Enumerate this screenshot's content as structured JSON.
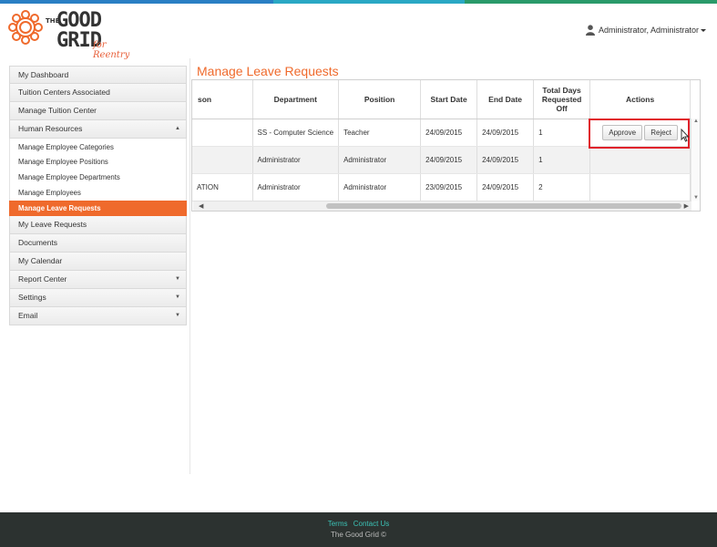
{
  "colors": {
    "accent": "#ef6a2c",
    "topbar": [
      "#2a7fc4",
      "#2aa8c4",
      "#2a9a6a"
    ],
    "highlight_box": "#e0202a",
    "footer_link": "#3bc1b5"
  },
  "header": {
    "logo": {
      "the": "THE",
      "good": "GOOD",
      "grid": "GRID",
      "tagline": "for Reentry"
    },
    "user_name": "Administrator, Administrator"
  },
  "sidebar": {
    "items": [
      {
        "label": "My Dashboard"
      },
      {
        "label": "Tuition Centers Associated"
      },
      {
        "label": "Manage Tuition Center"
      },
      {
        "label": "Human Resources",
        "expanded": true
      },
      {
        "label": "Manage Employee Categories"
      },
      {
        "label": "Manage Employee Positions"
      },
      {
        "label": "Manage Employee Departments"
      },
      {
        "label": "Manage Employees"
      },
      {
        "label": "Manage Leave Requests",
        "active": true
      },
      {
        "label": "My Leave Requests"
      },
      {
        "label": "Documents"
      },
      {
        "label": "My Calendar"
      },
      {
        "label": "Report Center"
      },
      {
        "label": "Settings"
      },
      {
        "label": "Email"
      }
    ]
  },
  "main": {
    "title": "Manage Leave Requests",
    "table": {
      "headers": {
        "reason": "son",
        "department": "Department",
        "position": "Position",
        "start_date": "Start Date",
        "end_date": "End Date",
        "total_days": "Total Days Requested Off",
        "actions": "Actions"
      },
      "rows": [
        {
          "reason": "",
          "department": "SS - Computer Science",
          "position": "Teacher",
          "start_date": "24/09/2015",
          "end_date": "24/09/2015",
          "total_days": "1",
          "has_actions": true
        },
        {
          "reason": "",
          "department": "Administrator",
          "position": "Administrator",
          "start_date": "24/09/2015",
          "end_date": "24/09/2015",
          "total_days": "1",
          "has_actions": false
        },
        {
          "reason": "ATION",
          "department": "Administrator",
          "position": "Administrator",
          "start_date": "23/09/2015",
          "end_date": "24/09/2015",
          "total_days": "2",
          "has_actions": false
        }
      ],
      "actions": {
        "approve": "Approve",
        "reject": "Reject"
      }
    }
  },
  "footer": {
    "terms": "Terms",
    "contact": "Contact Us",
    "copyright": "The Good Grid ©"
  }
}
